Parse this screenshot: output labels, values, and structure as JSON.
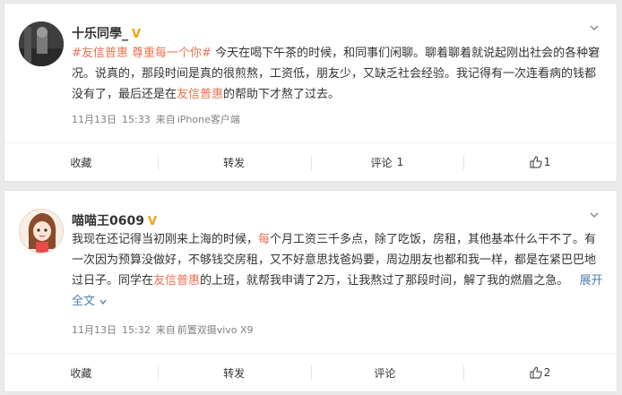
{
  "posts": [
    {
      "username": "十乐同學_",
      "verified_badge": "V",
      "content": {
        "hashtag1": "#友信普惠",
        "hashtag2": "尊重每一个你#",
        "text1": " 今天在喝下午茶的时候，和同事们闲聊。聊着聊着就说起刚出社会的各种窘况。说真的，那段时间是真的很煎熬，工资低，朋友少，又缺乏社会经验。我记得有一次连看病的钱都没有了，最后还是在",
        "link": "友信普惠",
        "text2": "的帮助下才熬了过去。"
      },
      "date": "11月13日",
      "time": "15:33",
      "source_prefix": "来自",
      "source": "iPhone客户端",
      "actions": {
        "favorite": "收藏",
        "repost": "转发",
        "comment": "评论",
        "comment_count": "1",
        "like_count": "1"
      }
    },
    {
      "username": "喵喵王0609",
      "verified_badge": "V",
      "content": {
        "text1": "我现在还记得当初刚来上海的时候，",
        "hl1": "每",
        "text2": "个月工资三千多点，除了吃饭，房租，其他基本什么干不了。有一次因为预算没做好，不够钱交房租，又不好意思找爸妈要，周边朋友也都和我一样，都是在紧巴巴地过日子。同学在",
        "link": "友信普惠",
        "text3": "的上班，就帮我申请了2万，让我熬过了那段时间，解了我的燃眉之急。",
        "expand": "展开全文",
        "expand_icon": "chevron-down-icon"
      },
      "date": "11月13日",
      "time": "15:32",
      "source_prefix": "来自",
      "source": "前置双摄vivo X9",
      "actions": {
        "favorite": "收藏",
        "repost": "转发",
        "comment": "评论",
        "comment_count": "",
        "like_count": "2"
      }
    }
  ],
  "colors": {
    "accent": "#eb7350",
    "link_blue": "#507daf",
    "verified": "#f2a20c",
    "meta_text": "#808080",
    "background": "#eaeaea"
  }
}
